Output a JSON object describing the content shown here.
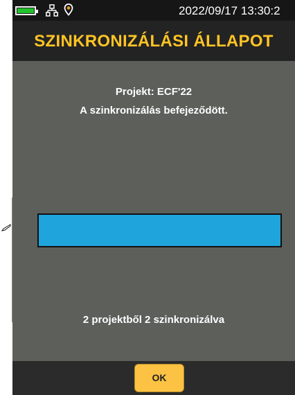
{
  "status_bar": {
    "datetime": "2022/09/17 13:30:2",
    "battery_level": 1.0,
    "battery_color": "#22c22c",
    "icons": [
      "battery-icon",
      "network-icon",
      "location-pin-icon"
    ]
  },
  "header": {
    "title": "SZINKRONIZÁLÁSI ÁLLAPOT",
    "title_color": "#ffc424"
  },
  "main": {
    "project_line": "Projekt: ECF'22",
    "status_line": "A szinkronizálás befejeződött.",
    "progress": {
      "value": 1.0,
      "color": "#1fa5dc"
    },
    "summary_line": "2 projektből 2 szinkronizálva"
  },
  "footer": {
    "ok_label": "OK",
    "ok_color": "#fcc243"
  }
}
